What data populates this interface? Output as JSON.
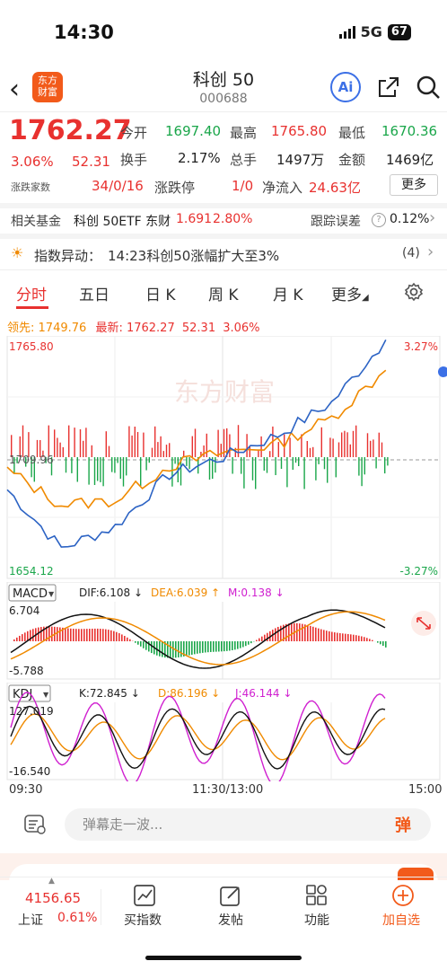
{
  "status": {
    "time": "14:30",
    "network": "5G",
    "battery": "67"
  },
  "header": {
    "logo_text_1": "东方",
    "logo_text_2": "财富",
    "title": "科创 50",
    "code": "000688",
    "ai_label": "Ai"
  },
  "quote": {
    "price": "1762.27",
    "change_pct": "3.06%",
    "change": "52.31",
    "open_label": "今开",
    "open": "1697.40",
    "high_label": "最高",
    "high": "1765.80",
    "low_label": "最低",
    "low": "1670.36",
    "turnover_label": "换手",
    "turnover": "2.17%",
    "volume_label": "总手",
    "volume": "1497万",
    "amount_label": "金额",
    "amount": "1469亿",
    "breadth_label": "涨跌家数",
    "breadth": "34/0/16",
    "limit_label": "涨跌停",
    "limit": "1/0",
    "inflow_label": "净流入",
    "inflow": "24.63亿",
    "more_label": "更多"
  },
  "fund": {
    "label": "相关基金",
    "name": "科创 50ETF 东财",
    "price": "1.691",
    "pct": "2.80%",
    "track_label": "跟踪误差",
    "track_value": "0.12%"
  },
  "alert": {
    "label": "指数异动：",
    "text": "14:23科创50涨幅扩大至3%",
    "count": "(4)"
  },
  "tabs": [
    {
      "label": "分时"
    },
    {
      "label": "五日"
    },
    {
      "label": "日 K"
    },
    {
      "label": "周 K"
    },
    {
      "label": "月 K"
    },
    {
      "label": "更多"
    }
  ],
  "chart_header": {
    "lead_label": "领先:",
    "lead": "1749.76",
    "latest_label": "最新:",
    "latest": "1762.27",
    "change": "52.31",
    "pct": "3.06%"
  },
  "chart": {
    "y_max": "1765.80",
    "y_mid": "1709.96",
    "y_min": "1654.12",
    "pct_max": "3.27%",
    "pct_min": "-3.27%",
    "watermark": "东方财富",
    "x_start": "09:30",
    "x_mid": "11:30/13:00",
    "x_end": "15:00"
  },
  "macd": {
    "label": "MACD",
    "dif": "DIF:6.108 ↓",
    "dea": "DEA:6.039 ↑",
    "m": "M:0.138 ↓",
    "y_max": "6.704",
    "y_min": "-5.788"
  },
  "kdj": {
    "label": "KDJ",
    "k": "K:72.845 ↓",
    "d": "D:86.196 ↓",
    "j": "J:46.144 ↓",
    "y_max": "127.019",
    "y_min": "-16.540"
  },
  "comment": {
    "placeholder": "弹幕走一波...",
    "danmu": "弹"
  },
  "bottom_nav": {
    "index_value": "4156.65",
    "index_name": "上证",
    "index_pct": "0.61%",
    "items": [
      {
        "label": "买指数"
      },
      {
        "label": "发帖"
      },
      {
        "label": "功能"
      },
      {
        "label": "加自选"
      }
    ]
  },
  "chart_data": {
    "type": "line",
    "title": "",
    "x_range": [
      "09:30",
      "15:00"
    ],
    "ylim": [
      1654.12,
      1765.8
    ],
    "prev_close": 1709.96,
    "series": [
      {
        "name": "最新",
        "x": [
          "09:30",
          "10:00",
          "10:30",
          "11:00",
          "11:30",
          "13:30",
          "14:00",
          "14:30"
        ],
        "values": [
          1695,
          1668,
          1678,
          1702,
          1710,
          1720,
          1735,
          1764
        ]
      },
      {
        "name": "领先",
        "x": [
          "09:30",
          "10:00",
          "10:30",
          "11:00",
          "11:30",
          "13:30",
          "14:00",
          "14:30"
        ],
        "values": [
          1704,
          1688,
          1690,
          1706,
          1712,
          1716,
          1728,
          1750
        ]
      }
    ]
  }
}
